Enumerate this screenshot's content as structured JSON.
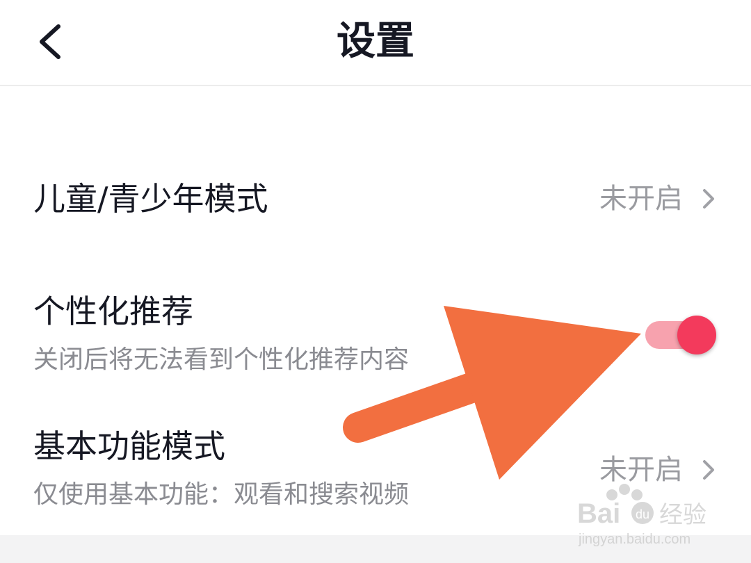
{
  "header": {
    "title": "设置",
    "back_icon": "chevron-left-icon"
  },
  "settings": [
    {
      "title": "儿童/青少年模式",
      "value": "未开启",
      "icon": "chevron-right-icon"
    },
    {
      "title": "个性化推荐",
      "subtitle": "关闭后将无法看到个性化推荐内容",
      "toggle_on": true,
      "toggle_color": "#f33a5c"
    },
    {
      "title": "基本功能模式",
      "subtitle": "仅使用基本功能：观看和搜索视频",
      "value": "未开启",
      "icon": "chevron-right-icon"
    }
  ],
  "annotation": {
    "arrow_color": "#f26f40"
  },
  "watermark": {
    "brand": "Bai 经验",
    "url": "jingyan.baidu.com"
  }
}
